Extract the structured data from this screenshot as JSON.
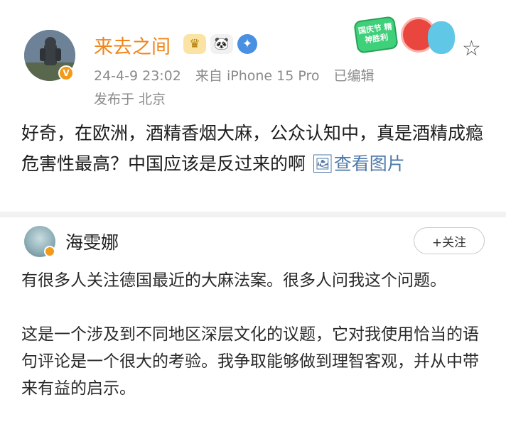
{
  "post": {
    "author": "来去之间",
    "timestamp": "24-4-9 23:02",
    "source": "来自 iPhone 15 Pro",
    "edited": "已编辑",
    "location": "发布于 北京",
    "text": "好奇，在欧洲，酒精香烟大麻，公众认知中，真是酒精成瘾危害性最高？中国应该是反过来的啊",
    "image_link": "查看图片",
    "sticker_text": "国庆节 精神胜利",
    "icons": [
      "avatar-icon",
      "verified-badge-icon",
      "gold-badge-icon",
      "panda-icon",
      "blue-badge-icon",
      "star-icon",
      "image-icon"
    ]
  },
  "quoted": {
    "name": "海雯娜",
    "follow_label": "+关注",
    "paragraph1": "有很多人关注德国最近的大麻法案。很多人问我这个问题。",
    "paragraph2": "这是一个涉及到不同地区深层文化的议题，它对我使用恰当的语句评论是一个很大的考验。我争取能够做到理智客观，并从中带来有益的启示。"
  },
  "colors": {
    "name_orange": "#f08519",
    "link_blue": "#4e78a8",
    "meta_gray": "#8a8a8a"
  }
}
